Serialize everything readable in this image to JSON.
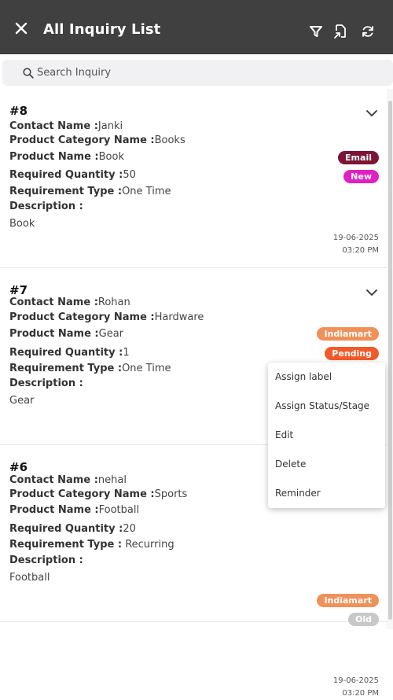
{
  "appbar": {
    "title": "All Inquiry List",
    "icons": [
      "close-icon",
      "filter-icon",
      "export-icon",
      "refresh-icon"
    ]
  },
  "search": {
    "placeholder": "Search Inquiry"
  },
  "labels": {
    "contact": "Contact Name :",
    "category": "Product Category Name :",
    "product": "Product Name :",
    "qty": "Required Quantity :",
    "reqtype": "Requirement Type :",
    "desc": "Description :"
  },
  "cards": [
    {
      "number": "#8",
      "contact": "Janki",
      "category": "Books",
      "product": "Book",
      "qty": "50",
      "reqtype": "One Time",
      "description": "Book",
      "source": "Email",
      "status": "New",
      "date": "19-06-2025",
      "time": "03:20 PM"
    },
    {
      "number": "#7",
      "contact": "Rohan",
      "category": "Hardware",
      "product": "Gear",
      "qty": "1",
      "reqtype": "One Time",
      "description": "Gear",
      "source": "Indiamart",
      "status": "Pending"
    },
    {
      "number": "#6",
      "contact": "nehal",
      "category": "Sports",
      "product": "Football",
      "qty": "20",
      "reqtype": " Recurring",
      "description": "Football",
      "source": "Indiamart",
      "status": "Old",
      "date": "19-06-2025",
      "time": "03:20 PM"
    }
  ],
  "menu": [
    "Assign label",
    "Assign Status/Stage",
    "Edit",
    "Delete",
    "Reminder"
  ],
  "colors": {
    "appbar": "#404040",
    "email_badge": "#7b1536",
    "new_badge": "#e020c0",
    "indiamart_badge": "#f0915a",
    "pending_badge": "#f25a2a",
    "old_badge": "#c8c8c8"
  }
}
